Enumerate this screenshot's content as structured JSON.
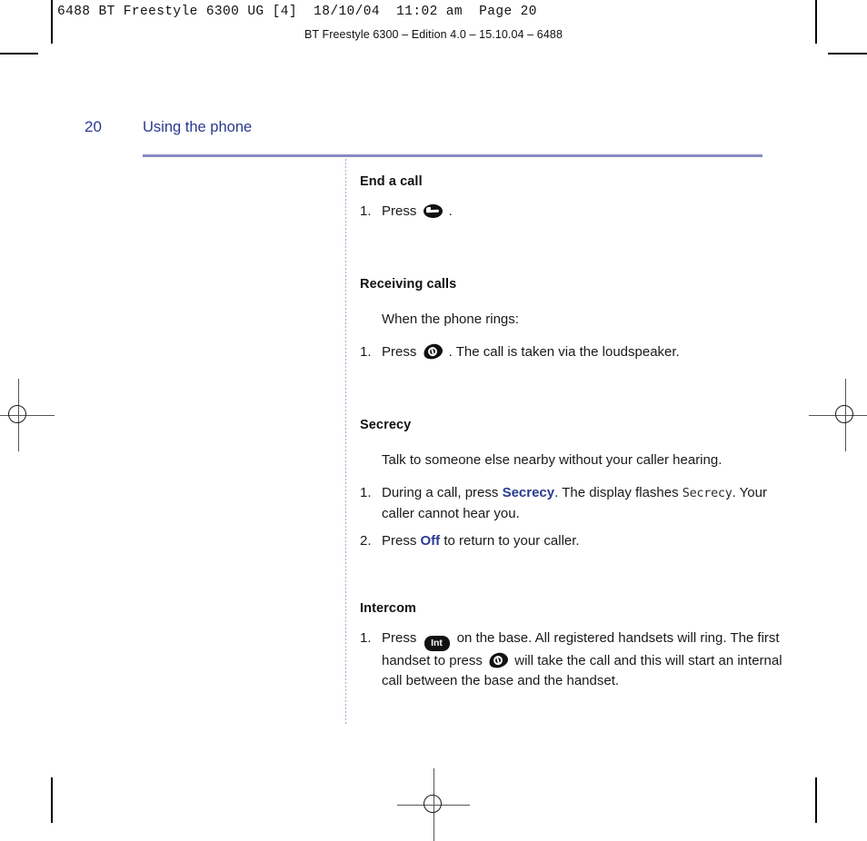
{
  "print_marks": {
    "slug": "6488 BT Freestyle 6300 UG [4]  18/10/04  11:02 am  Page 20",
    "running_head": "BT Freestyle 6300 – Edition 4.0 – 15.10.04 – 6488"
  },
  "colors": {
    "heading_blue": "#2a3b8f",
    "rule_lavender": "#8a8ac4",
    "divider_lavender": "#a9a9d4",
    "body_text": "#1a1a1a",
    "key_black": "#111111"
  },
  "page": {
    "number": "20",
    "title": "Using the phone"
  },
  "sections": [
    {
      "id": "end-a-call",
      "heading": "End a call",
      "steps": [
        {
          "number": "1.",
          "parts": [
            {
              "type": "text",
              "value": "Press "
            },
            {
              "type": "icon",
              "icon": "end-call-key",
              "label": ""
            },
            {
              "type": "text",
              "value": " ."
            }
          ]
        }
      ]
    },
    {
      "id": "receiving-calls",
      "heading": "Receiving calls",
      "lead": "When the phone rings:",
      "steps": [
        {
          "number": "1.",
          "parts": [
            {
              "type": "text",
              "value": "Press "
            },
            {
              "type": "icon",
              "icon": "talk-key",
              "label": ""
            },
            {
              "type": "text",
              "value": " . The call is taken via the loudspeaker."
            }
          ]
        }
      ]
    },
    {
      "id": "secrecy",
      "heading": "Secrecy",
      "lead": "Talk to someone else nearby without your caller hearing.",
      "steps": [
        {
          "number": "1.",
          "parts": [
            {
              "type": "text",
              "value": "During a call, press "
            },
            {
              "type": "blue",
              "value": "Secrecy"
            },
            {
              "type": "text",
              "value": ". The display flashes "
            },
            {
              "type": "lcd",
              "value": "Secrecy"
            },
            {
              "type": "text",
              "value": ". Your caller cannot hear you."
            }
          ]
        },
        {
          "number": "2.",
          "parts": [
            {
              "type": "text",
              "value": "Press "
            },
            {
              "type": "blue",
              "value": "Off"
            },
            {
              "type": "text",
              "value": " to return to your caller."
            }
          ]
        }
      ]
    },
    {
      "id": "intercom",
      "heading": "Intercom",
      "steps": [
        {
          "number": "1.",
          "parts": [
            {
              "type": "text",
              "value": "Press "
            },
            {
              "type": "icon",
              "icon": "int-key",
              "label": "Int"
            },
            {
              "type": "text",
              "value": " on the base. All registered handsets will ring. The first handset to press "
            },
            {
              "type": "icon",
              "icon": "talk-key",
              "label": ""
            },
            {
              "type": "text",
              "value": " will take the call and this will start an internal call between the base and the handset."
            }
          ]
        }
      ]
    }
  ]
}
